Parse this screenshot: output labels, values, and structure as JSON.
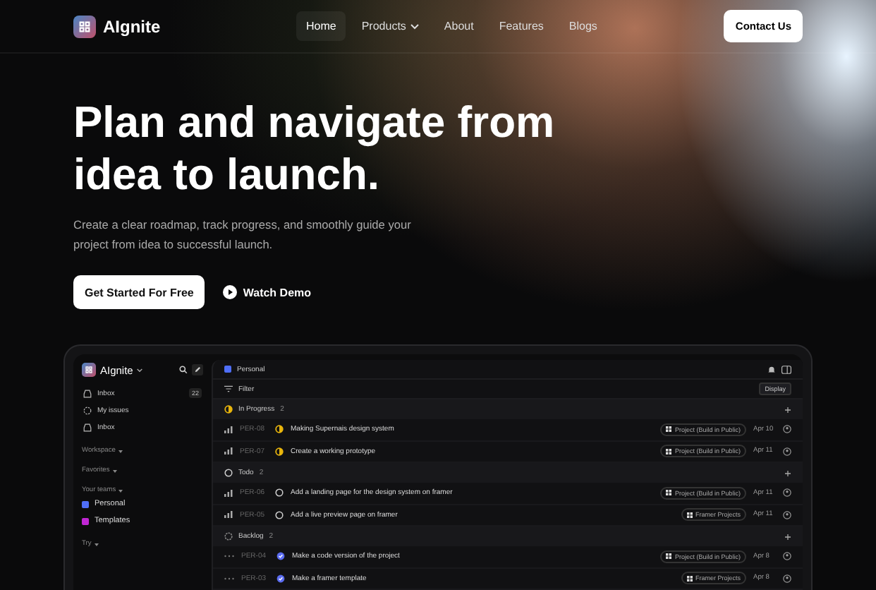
{
  "brand": {
    "name": "AIgnite"
  },
  "nav": [
    {
      "label": "Home",
      "selected": true,
      "dropdown": false
    },
    {
      "label": "Products",
      "selected": false,
      "dropdown": true
    },
    {
      "label": "About",
      "selected": false,
      "dropdown": false
    },
    {
      "label": "Features",
      "selected": false,
      "dropdown": false
    },
    {
      "label": "Blogs",
      "selected": false,
      "dropdown": false
    }
  ],
  "contact_button": "Contact Us",
  "hero": {
    "title": "Plan and navigate from idea to launch.",
    "subtitle": "Create a clear roadmap, track progress, and smoothly guide your project from idea to successful launch.",
    "primary_button": "Get Started For Free",
    "secondary_button": "Watch Demo"
  },
  "app": {
    "sidebar": {
      "brand": "AIgnite",
      "items": [
        {
          "label": "Inbox",
          "kind": "inbox",
          "badge": "22"
        },
        {
          "label": "My issues",
          "kind": "issues"
        },
        {
          "label": "Inbox",
          "kind": "inbox"
        }
      ],
      "sections": [
        {
          "label": "Workspace"
        },
        {
          "label": "Favorites"
        },
        {
          "label": "Your teams",
          "teams": [
            {
              "label": "Personal",
              "color": "#4f6ef7"
            },
            {
              "label": "Templates",
              "color": "#c026d3"
            }
          ]
        },
        {
          "label": "Try"
        }
      ]
    },
    "header": {
      "title": "Personal",
      "filter": "Filter",
      "display": "Display"
    },
    "groups": [
      {
        "name": "In Progress",
        "icon": {
          "kind": "progress"
        },
        "count": "2",
        "rows": [
          {
            "priority": {
              "kind": "bars"
            },
            "id": "PER-08",
            "status": {
              "kind": "progress"
            },
            "title": "Making Supernais design system",
            "project": "Project (Build in Public)",
            "date": "Apr 10"
          },
          {
            "priority": {
              "kind": "bars"
            },
            "id": "PER-07",
            "status": {
              "kind": "progress"
            },
            "title": "Create a working prototype",
            "project": "Project (Build in Public)",
            "date": "Apr 11"
          }
        ]
      },
      {
        "name": "Todo",
        "icon": {
          "kind": "todo"
        },
        "count": "2",
        "rows": [
          {
            "priority": {
              "kind": "bars"
            },
            "id": "PER-06",
            "status": {
              "kind": "todo"
            },
            "title": "Add a landing page for the design system on framer",
            "project": "Project (Build in Public)",
            "date": "Apr 11"
          },
          {
            "priority": {
              "kind": "bars"
            },
            "id": "PER-05",
            "status": {
              "kind": "todo"
            },
            "title": "Add a live preview page on framer",
            "project": "Framer Projects",
            "date": "Apr 11"
          }
        ]
      },
      {
        "name": "Backlog",
        "icon": {
          "kind": "backlog"
        },
        "count": "2",
        "rows": [
          {
            "priority": {
              "kind": "dots"
            },
            "id": "PER-04",
            "status": {
              "kind": "done"
            },
            "title": "Make a code version of the project",
            "project": "Project (Build in Public)",
            "date": "Apr 8"
          },
          {
            "priority": {
              "kind": "dots"
            },
            "id": "PER-03",
            "status": {
              "kind": "done"
            },
            "title": "Make a framer template",
            "project": "Framer Projects",
            "date": "Apr 8"
          }
        ]
      }
    ]
  }
}
